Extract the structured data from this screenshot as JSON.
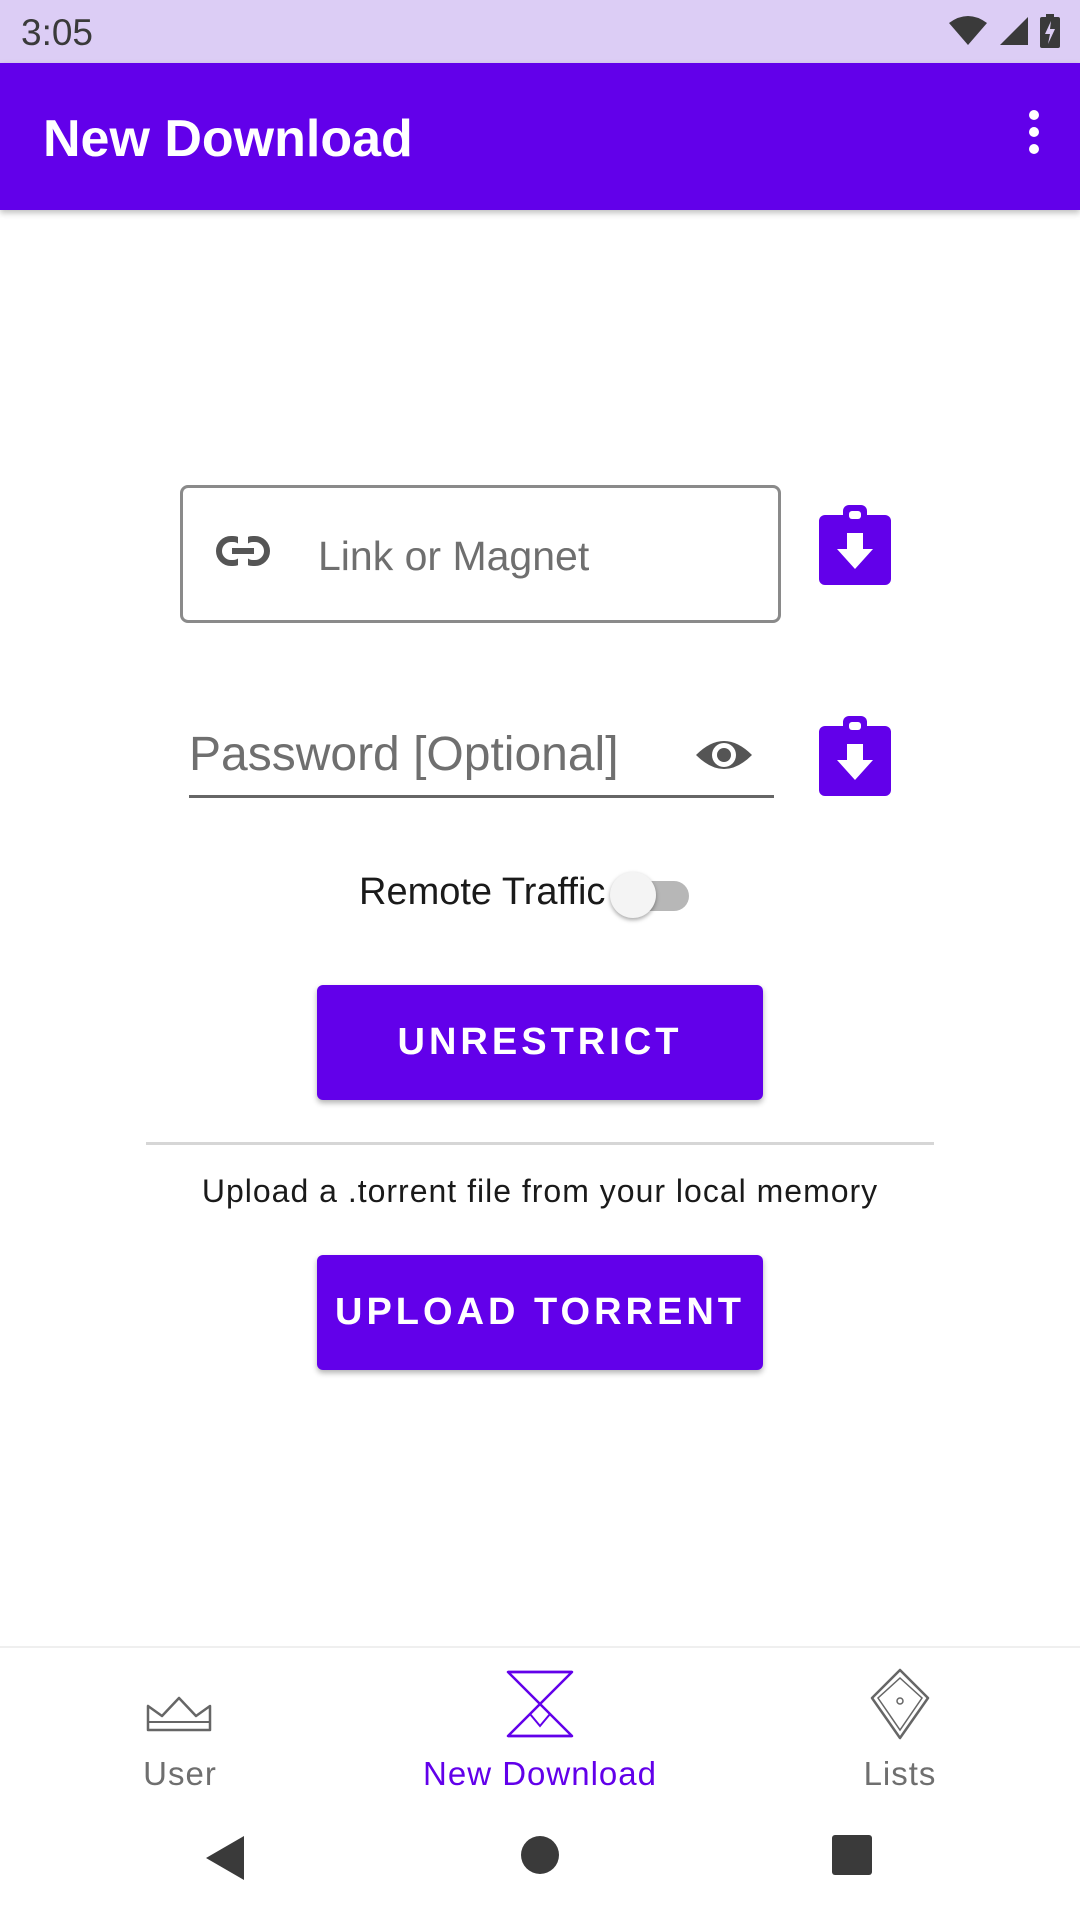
{
  "status_bar": {
    "time": "3:05",
    "icons": [
      "wifi-icon",
      "cell-signal-icon",
      "battery-charging-icon"
    ]
  },
  "app_bar": {
    "title": "New Download",
    "menu_icon": "more-vert-icon"
  },
  "link_input": {
    "placeholder": "Link or Magnet",
    "value": "",
    "icon": "link-icon"
  },
  "password_input": {
    "placeholder": "Password [Optional]",
    "value": "",
    "icon": "eye-icon"
  },
  "paste_buttons": {
    "icon": "clipboard-download-icon"
  },
  "remote_traffic": {
    "label": "Remote Traffic",
    "enabled": false
  },
  "unrestrict_button": {
    "label": "UNRESTRICT"
  },
  "upload_section": {
    "text": "Upload a .torrent file from your local memory",
    "button_label": "UPLOAD TORRENT"
  },
  "bottom_nav": {
    "items": [
      {
        "label": "User",
        "icon": "crown-icon",
        "active": false
      },
      {
        "label": "New Download",
        "icon": "hourglass-icon",
        "active": true
      },
      {
        "label": "Lists",
        "icon": "diamond-icon",
        "active": false
      }
    ]
  },
  "colors": {
    "primary": "#6200ea",
    "status_bar": "#dccdf5",
    "inactive": "#6f6f6f"
  }
}
